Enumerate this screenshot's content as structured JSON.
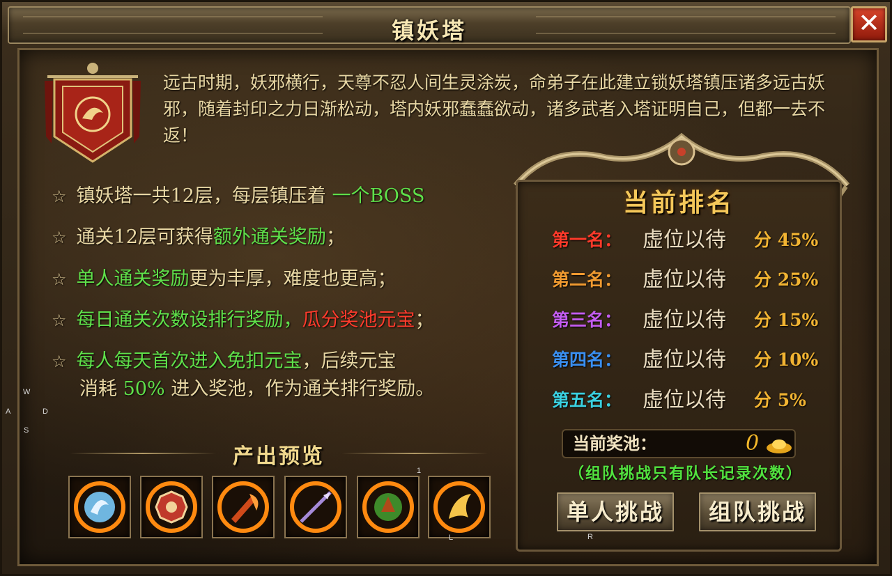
{
  "title": "镇妖塔",
  "close_symbol": "✕",
  "intro": "远古时期，妖邪横行，天尊不忍人间生灵涂炭，命弟子在此建立锁妖塔镇压诸多远古妖邪，随着封印之力日渐松动，塔内妖邪蠢蠢欲动，诸多武者入塔证明自己，但都一去不返！",
  "rules": {
    "star": "☆",
    "r1_a": "镇妖塔一共12层，每层镇压着 ",
    "r1_b": "一个BOSS",
    "r2_a": "通关12层可获得",
    "r2_b": "额外通关奖励",
    "r2_c": "；",
    "r3_a": "单人通关奖励",
    "r3_b": "更为丰厚，难度也更高；",
    "r4_a": "每日通关次数设排行奖励，",
    "r4_b": "瓜分奖池元宝",
    "r4_c": "；",
    "r5_a": "每人每天首次进入免扣元宝",
    "r5_b": "，后续元宝",
    "r5c_a": "消耗",
    "r5c_b": "50%",
    "r5c_c": "进入奖池，作为通关排行奖励。"
  },
  "preview": {
    "title": "产出预览",
    "items": [
      {
        "icon": "dragon-icon"
      },
      {
        "icon": "bagua-icon"
      },
      {
        "icon": "axe-icon"
      },
      {
        "icon": "spear-icon"
      },
      {
        "icon": "green-orb-icon"
      },
      {
        "icon": "golden-wing-icon"
      }
    ]
  },
  "ranking": {
    "title": "当前排名",
    "rows": [
      {
        "label": "第一名：",
        "name": "虚位以待",
        "pct": "分 45%",
        "color": "#ff3a2a"
      },
      {
        "label": "第二名：",
        "name": "虚位以待",
        "pct": "分 25%",
        "color": "#f09a30"
      },
      {
        "label": "第三名：",
        "name": "虚位以待",
        "pct": "分 15%",
        "color": "#c35cf0"
      },
      {
        "label": "第四名：",
        "name": "虚位以待",
        "pct": "分 10%",
        "color": "#3a8ff0"
      },
      {
        "label": "第五名：",
        "name": "虚位以待",
        "pct": "分 5%",
        "color": "#3ad0e0"
      }
    ],
    "pool_label": "当前奖池：",
    "pool_value": "0",
    "note": "（组队挑战只有队长记录次数）",
    "solo_button": "单人挑战",
    "team_button": "组队挑战"
  },
  "overlay_keys": {
    "w": "W",
    "a": "A",
    "d": "D",
    "s": "S",
    "one": "1",
    "l": "L",
    "r": "R"
  }
}
